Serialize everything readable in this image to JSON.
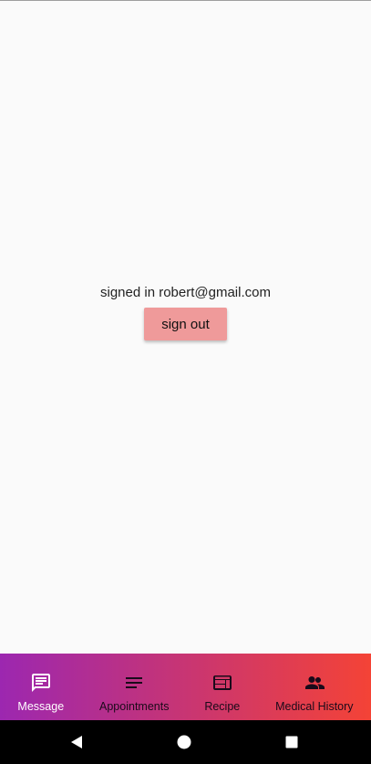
{
  "account": {
    "signed_in_text": "signed in robert@gmail.com",
    "sign_out_label": "sign out"
  },
  "bottom_nav": {
    "gradient_start": "#9c27b0",
    "gradient_end": "#f44336",
    "active_index": 0,
    "items": [
      {
        "label": "Message",
        "icon": "message-icon"
      },
      {
        "label": "Appointments",
        "icon": "list-icon"
      },
      {
        "label": "Recipe",
        "icon": "web-icon"
      },
      {
        "label": "Medical History",
        "icon": "supervisor-account-icon"
      }
    ]
  },
  "system_nav": {
    "buttons": [
      "back-icon",
      "home-icon",
      "recents-icon"
    ]
  }
}
